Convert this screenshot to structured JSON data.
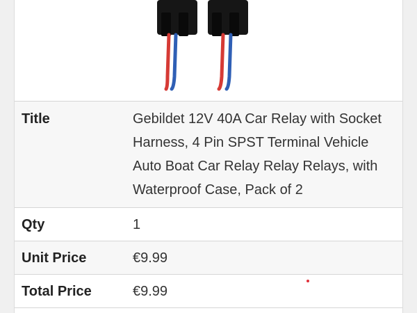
{
  "product": {
    "image_icon": "relay-with-wire-harness",
    "colors": {
      "wire_red": "#d63a35",
      "wire_blue": "#2f5fb5",
      "housing": "#161616",
      "marker_dot": "#e0303a"
    }
  },
  "details": {
    "rows": [
      {
        "label": "Title",
        "value": "Gebildet 12V 40A Car Relay with Socket Harness, 4 Pin SPST Terminal Vehicle Auto Boat Car Relay Relay Relays, with Waterproof Case, Pack of 2"
      },
      {
        "label": "Qty",
        "value": "1"
      },
      {
        "label": "Unit Price",
        "value": "€9.99"
      },
      {
        "label": "Total Price",
        "value": "€9.99"
      }
    ]
  }
}
